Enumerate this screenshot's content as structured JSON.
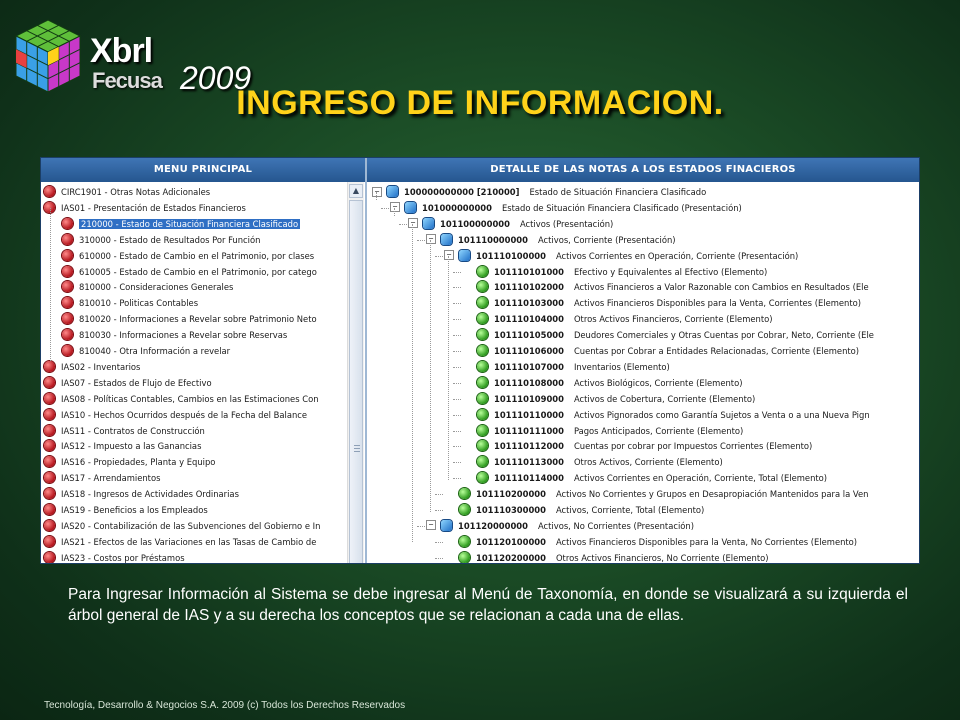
{
  "logo": {
    "line1": "Xbrl",
    "line2": "Fecusa",
    "year": "2009"
  },
  "title": "INGRESO DE INFORMACION.",
  "app": {
    "left_header": "MENU PRINCIPAL",
    "right_header": "DETALLE DE LAS NOTAS A LOS ESTADOS FINACIEROS",
    "left_tree": [
      {
        "text": "CIRC1901 - Otras Notas Adicionales",
        "level": 0,
        "selected": false
      },
      {
        "text": "IAS01 - Presentación de Estados Financieros",
        "level": 0,
        "selected": false
      },
      {
        "text": "210000 - Estado de Situación Financiera Clasificado",
        "level": 1,
        "selected": true
      },
      {
        "text": "310000 - Estado de Resultados Por Función",
        "level": 1,
        "selected": false
      },
      {
        "text": "610000 - Estado de Cambio en el Patrimonio, por clases",
        "level": 1,
        "selected": false
      },
      {
        "text": "610005 - Estado de Cambio en el Patrimonio, por catego",
        "level": 1,
        "selected": false
      },
      {
        "text": "810000 - Consideraciones Generales",
        "level": 1,
        "selected": false
      },
      {
        "text": "810010 - Politicas Contables",
        "level": 1,
        "selected": false
      },
      {
        "text": "810020 - Informaciones a Revelar sobre Patrimonio Neto",
        "level": 1,
        "selected": false
      },
      {
        "text": "810030 - Informaciones a Revelar sobre Reservas",
        "level": 1,
        "selected": false
      },
      {
        "text": "810040 - Otra Información a revelar",
        "level": 1,
        "selected": false
      },
      {
        "text": "IAS02 - Inventarios",
        "level": 0,
        "selected": false
      },
      {
        "text": "IAS07 - Estados de Flujo de Efectivo",
        "level": 0,
        "selected": false
      },
      {
        "text": "IAS08 - Políticas Contables, Cambios en las Estimaciones Con",
        "level": 0,
        "selected": false
      },
      {
        "text": "IAS10 - Hechos Ocurridos después de la Fecha del Balance",
        "level": 0,
        "selected": false
      },
      {
        "text": "IAS11 - Contratos de Construcción",
        "level": 0,
        "selected": false
      },
      {
        "text": "IAS12 - Impuesto a las Ganancias",
        "level": 0,
        "selected": false
      },
      {
        "text": "IAS16 - Propiedades, Planta y Equipo",
        "level": 0,
        "selected": false
      },
      {
        "text": "IAS17 - Arrendamientos",
        "level": 0,
        "selected": false
      },
      {
        "text": "IAS18 - Ingresos de Actividades Ordinarias",
        "level": 0,
        "selected": false
      },
      {
        "text": "IAS19 - Beneficios a los Empleados",
        "level": 0,
        "selected": false
      },
      {
        "text": "IAS20 - Contabilización de las Subvenciones del Gobierno e In",
        "level": 0,
        "selected": false
      },
      {
        "text": "IAS21 - Efectos de las Variaciones en las Tasas de Cambio de",
        "level": 0,
        "selected": false
      },
      {
        "text": "IAS23 - Costos por Préstamos",
        "level": 0,
        "selected": false
      }
    ],
    "right_tree": [
      {
        "code": "100000000000 [210000]",
        "desc": "Estado de Situación Financiera Clasificado",
        "level": 0,
        "icon": "blue",
        "toggle": "−"
      },
      {
        "code": "101000000000",
        "desc": "Estado de Situación Financiera Clasificado (Presentación)",
        "level": 1,
        "icon": "blue",
        "toggle": "−"
      },
      {
        "code": "101100000000",
        "desc": "Activos (Presentación)",
        "level": 2,
        "icon": "blue",
        "toggle": "−"
      },
      {
        "code": "101110000000",
        "desc": "Activos, Corriente (Presentación)",
        "level": 3,
        "icon": "blue",
        "toggle": "−"
      },
      {
        "code": "101110100000",
        "desc": "Activos Corrientes en Operación, Corriente (Presentación)",
        "level": 4,
        "icon": "blue",
        "toggle": "−"
      },
      {
        "code": "101110101000",
        "desc": "Efectivo y Equivalentes al Efectivo (Elemento)",
        "level": 5,
        "icon": "green",
        "toggle": ""
      },
      {
        "code": "101110102000",
        "desc": "Activos Financieros a Valor Razonable con Cambios en Resultados (Ele",
        "level": 5,
        "icon": "green",
        "toggle": ""
      },
      {
        "code": "101110103000",
        "desc": "Activos Financieros Disponibles para la Venta, Corrientes (Elemento)",
        "level": 5,
        "icon": "green",
        "toggle": ""
      },
      {
        "code": "101110104000",
        "desc": "Otros Activos Financieros, Corriente (Elemento)",
        "level": 5,
        "icon": "green",
        "toggle": ""
      },
      {
        "code": "101110105000",
        "desc": "Deudores Comerciales y Otras Cuentas por Cobrar, Neto, Corriente (Ele",
        "level": 5,
        "icon": "green",
        "toggle": ""
      },
      {
        "code": "101110106000",
        "desc": "Cuentas por Cobrar a Entidades Relacionadas, Corriente (Elemento)",
        "level": 5,
        "icon": "green",
        "toggle": ""
      },
      {
        "code": "101110107000",
        "desc": "Inventarios (Elemento)",
        "level": 5,
        "icon": "green",
        "toggle": ""
      },
      {
        "code": "101110108000",
        "desc": "Activos Biológicos, Corriente (Elemento)",
        "level": 5,
        "icon": "green",
        "toggle": ""
      },
      {
        "code": "101110109000",
        "desc": "Activos de Cobertura, Corriente (Elemento)",
        "level": 5,
        "icon": "green",
        "toggle": ""
      },
      {
        "code": "101110110000",
        "desc": "Activos Pignorados como Garantía Sujetos a Venta o a una Nueva Pign",
        "level": 5,
        "icon": "green",
        "toggle": ""
      },
      {
        "code": "101110111000",
        "desc": "Pagos Anticipados, Corriente (Elemento)",
        "level": 5,
        "icon": "green",
        "toggle": ""
      },
      {
        "code": "101110112000",
        "desc": "Cuentas por cobrar por Impuestos Corrientes (Elemento)",
        "level": 5,
        "icon": "green",
        "toggle": ""
      },
      {
        "code": "101110113000",
        "desc": "Otros Activos, Corriente (Elemento)",
        "level": 5,
        "icon": "green",
        "toggle": ""
      },
      {
        "code": "101110114000",
        "desc": "Activos Corrientes en Operación, Corriente, Total (Elemento)",
        "level": 5,
        "icon": "green",
        "toggle": ""
      },
      {
        "code": "101110200000",
        "desc": "Activos No Corrientes y Grupos en Desapropiación Mantenidos para la Ven",
        "level": 4,
        "icon": "green",
        "toggle": ""
      },
      {
        "code": "101110300000",
        "desc": "Activos, Corriente, Total (Elemento)",
        "level": 4,
        "icon": "green",
        "toggle": ""
      },
      {
        "code": "101120000000",
        "desc": "Activos, No Corrientes (Presentación)",
        "level": 3,
        "icon": "blue",
        "toggle": "−"
      },
      {
        "code": "101120100000",
        "desc": "Activos Financieros Disponibles para la Venta, No Corrientes (Elemento)",
        "level": 4,
        "icon": "green",
        "toggle": ""
      },
      {
        "code": "101120200000",
        "desc": "Otros Activos Financieros, No Corriente (Elemento)",
        "level": 4,
        "icon": "green",
        "toggle": ""
      }
    ]
  },
  "note": "Para Ingresar Información al Sistema se debe ingresar al Menú de Taxonomía, en donde se visualizará a su izquierda el árbol general de IAS y a su derecha los conceptos que se relacionan a cada una de ellas.",
  "footer": "Tecnología, Desarrollo & Negocios S.A. 2009 (c) Todos los Derechos Reservados",
  "icons": {
    "scroll_up": "scroll-up-arrow-icon",
    "red_node": "red-sphere-node-icon",
    "blue_node": "blue-cube-node-icon",
    "green_node": "green-element-node-icon"
  },
  "colors": {
    "title": "#ffd21a",
    "header_blue": "#2f62a3",
    "selection": "#2f6fc4",
    "background": "#1a4a25"
  }
}
